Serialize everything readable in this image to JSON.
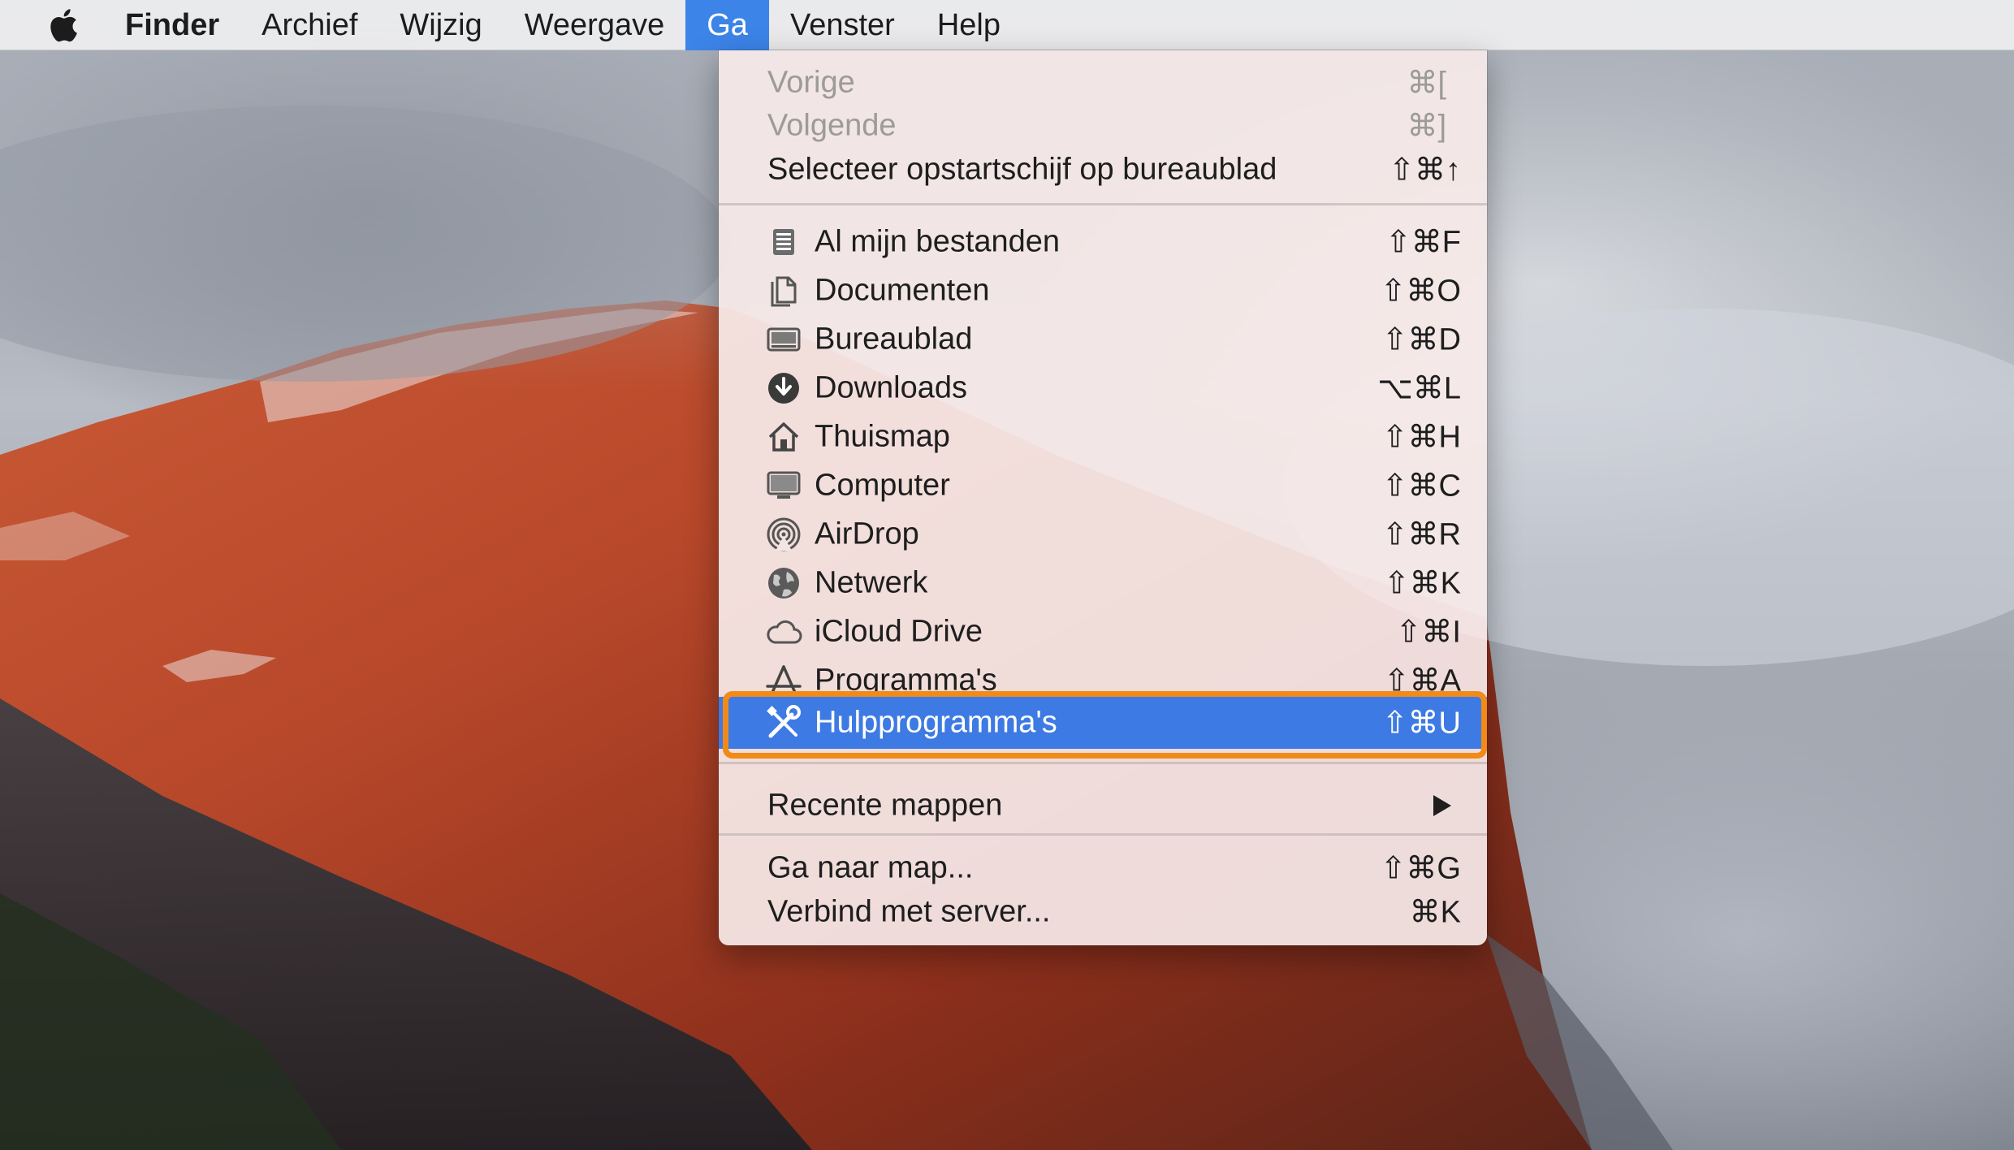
{
  "menubar": {
    "app_name": "Finder",
    "items": [
      "Archief",
      "Wijzig",
      "Weergave",
      "Ga",
      "Venster",
      "Help"
    ],
    "active": "Ga"
  },
  "go_menu": {
    "history": [
      {
        "label": "Vorige",
        "shortcut": "⌘[",
        "enabled": false
      },
      {
        "label": "Volgende",
        "shortcut": "⌘]",
        "enabled": false
      },
      {
        "label": "Selecteer opstartschijf op bureaublad",
        "shortcut": "⇧⌘↑",
        "enabled": true
      }
    ],
    "places": [
      {
        "label": "Al mijn bestanden",
        "shortcut": "⇧⌘F",
        "icon": "all-files-icon"
      },
      {
        "label": "Documenten",
        "shortcut": "⇧⌘O",
        "icon": "documents-icon"
      },
      {
        "label": "Bureaublad",
        "shortcut": "⇧⌘D",
        "icon": "desktop-icon"
      },
      {
        "label": "Downloads",
        "shortcut": "⌥⌘L",
        "icon": "downloads-icon"
      },
      {
        "label": "Thuismap",
        "shortcut": "⇧⌘H",
        "icon": "home-icon"
      },
      {
        "label": "Computer",
        "shortcut": "⇧⌘C",
        "icon": "computer-icon"
      },
      {
        "label": "AirDrop",
        "shortcut": "⇧⌘R",
        "icon": "airdrop-icon"
      },
      {
        "label": "Netwerk",
        "shortcut": "⇧⌘K",
        "icon": "network-icon"
      },
      {
        "label": "iCloud Drive",
        "shortcut": "⇧⌘I",
        "icon": "icloud-icon"
      },
      {
        "label": "Programma's",
        "shortcut": "⇧⌘A",
        "icon": "applications-icon"
      },
      {
        "label": "Hulpprogramma's",
        "shortcut": "⇧⌘U",
        "icon": "utilities-icon",
        "selected": true
      }
    ],
    "recent": {
      "label": "Recente mappen"
    },
    "actions": [
      {
        "label": "Ga naar map...",
        "shortcut": "⇧⌘G"
      },
      {
        "label": "Verbind met server...",
        "shortcut": "⌘K"
      }
    ]
  },
  "colors": {
    "menu_selection": "#3d7ae3",
    "highlight_frame": "#f28a18",
    "menubar_active": "#3c84e8"
  }
}
